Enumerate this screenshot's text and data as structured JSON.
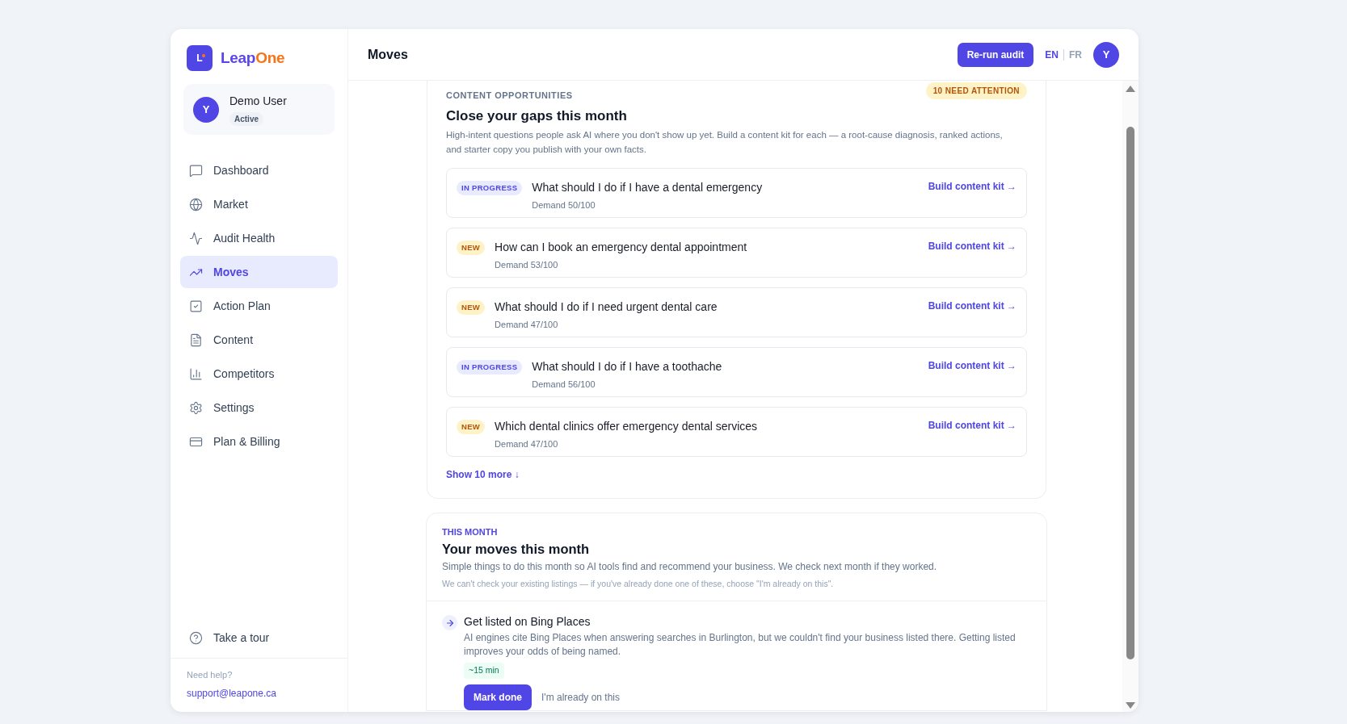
{
  "brand": {
    "mark": "L",
    "name_first": "Leap",
    "name_second": "One"
  },
  "user": {
    "initial": "Y",
    "name": "Demo User",
    "status": "Active"
  },
  "nav": [
    {
      "label": "Dashboard",
      "selected": false
    },
    {
      "label": "Market",
      "selected": false
    },
    {
      "label": "Audit Health",
      "selected": false
    },
    {
      "label": "Moves",
      "selected": true
    },
    {
      "label": "Action Plan",
      "selected": false
    },
    {
      "label": "Content",
      "selected": false
    },
    {
      "label": "Competitors",
      "selected": false
    },
    {
      "label": "Settings",
      "selected": false
    },
    {
      "label": "Plan & Billing",
      "selected": false
    }
  ],
  "tour": "Take a tour",
  "help": {
    "label": "Need help?",
    "email": "support@leapone.ca"
  },
  "header": {
    "title": "Moves",
    "button": "Re-run audit",
    "languages": [
      {
        "label": "EN",
        "selected": true
      },
      {
        "label": "FR",
        "selected": false
      }
    ],
    "avatar": "Y"
  },
  "opportunities": {
    "eyebrow": "CONTENT OPPORTUNITIES",
    "badge": "10 NEED ATTENTION",
    "title": "Close your gaps this month",
    "description": "High-intent questions people ask AI where you don't show up yet. Build a content kit for each — a root-cause diagnosis, ranked actions, and starter copy you publish with your own facts.",
    "items": [
      {
        "kind": "in_progress",
        "status": "IN PROGRESS",
        "question": "What should I do if I have a dental emergency",
        "demand": "Demand 50/100",
        "action": "Build content kit →"
      },
      {
        "kind": "new",
        "status": "NEW",
        "question": "How can I book an emergency dental appointment",
        "demand": "Demand 53/100",
        "action": "Build content kit →"
      },
      {
        "kind": "new",
        "status": "NEW",
        "question": "What should I do if I need urgent dental care",
        "demand": "Demand 47/100",
        "action": "Build content kit →"
      },
      {
        "kind": "in_progress",
        "status": "IN PROGRESS",
        "question": "What should I do if I have a toothache",
        "demand": "Demand 56/100",
        "action": "Build content kit →"
      },
      {
        "kind": "new",
        "status": "NEW",
        "question": "Which dental clinics offer emergency dental services",
        "demand": "Demand 47/100",
        "action": "Build content kit →"
      }
    ],
    "show_more": "Show 10 more ↓"
  },
  "moves": {
    "eyebrow": "THIS MONTH",
    "title": "Your moves this month",
    "description": "Simple things to do this month so AI tools find and recommend your business. We check next month if they worked.",
    "note": "We can't check your existing listings — if you've already done one of these, choose \"I'm already on this\".",
    "items": [
      {
        "title": "Get listed on Bing Places",
        "description": "AI engines cite Bing Places when answering searches in Burlington, but we couldn't find your business listed there. Getting listed improves your odds of being named.",
        "time": "~15 min",
        "primary": "Mark done",
        "secondary": "I'm already on this"
      }
    ]
  }
}
